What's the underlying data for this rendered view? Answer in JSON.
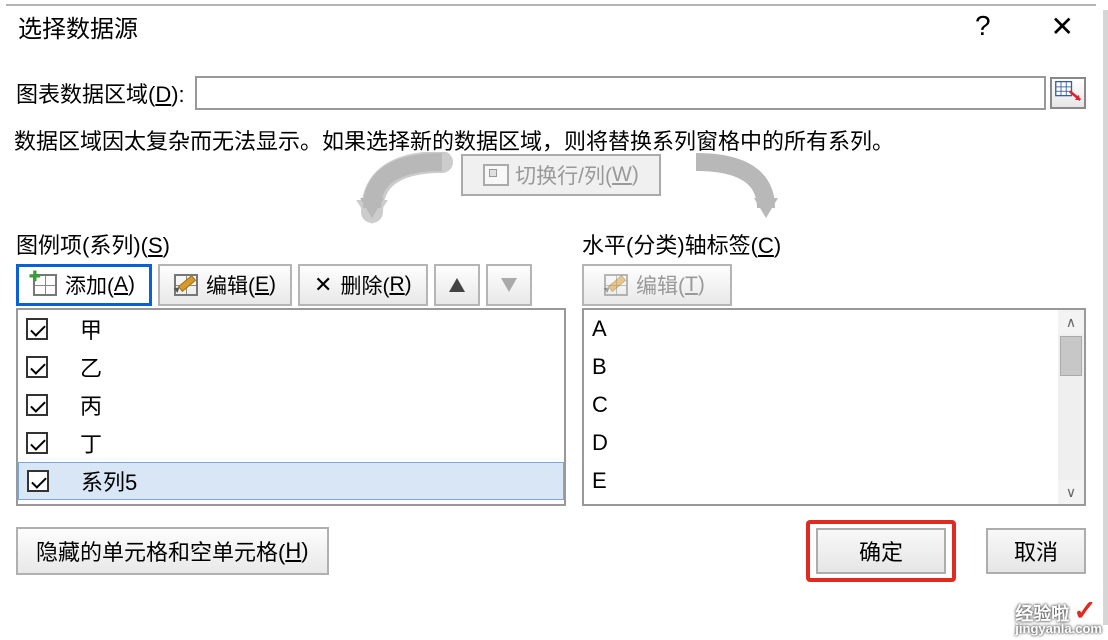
{
  "dialog": {
    "title": "选择数据源",
    "help": "?",
    "close": "✕"
  },
  "range": {
    "label_pre": "图表数据区域(",
    "label_u": "D",
    "label_post": "):",
    "value": ""
  },
  "warning": "数据区域因太复杂而无法显示。如果选择新的数据区域，则将替换系列窗格中的所有系列。",
  "swap": {
    "label_pre": "切换行/列(",
    "label_u": "W",
    "label_post": ")"
  },
  "legend": {
    "title_pre": "图例项(系列)(",
    "title_u": "S",
    "title_post": ")",
    "add_pre": "添加(",
    "add_u": "A",
    "add_post": ")",
    "edit_pre": "编辑(",
    "edit_u": "E",
    "edit_post": ")",
    "del_pre": "删除(",
    "del_u": "R",
    "del_post": ")",
    "items": [
      "甲",
      "乙",
      "丙",
      "丁",
      "系列5"
    ],
    "selected_index": 4
  },
  "axis": {
    "title_pre": "水平(分类)轴标签(",
    "title_u": "C",
    "title_post": ")",
    "edit_pre": "编辑(",
    "edit_u": "T",
    "edit_post": ")",
    "items": [
      "A",
      "B",
      "C",
      "D",
      "E"
    ]
  },
  "footer": {
    "hidden_pre": "隐藏的单元格和空单元格(",
    "hidden_u": "H",
    "hidden_post": ")",
    "ok": "确定",
    "cancel": "取消"
  },
  "watermark": {
    "brand": "经验啦",
    "check": "✓",
    "url": "jingyanla.com"
  }
}
